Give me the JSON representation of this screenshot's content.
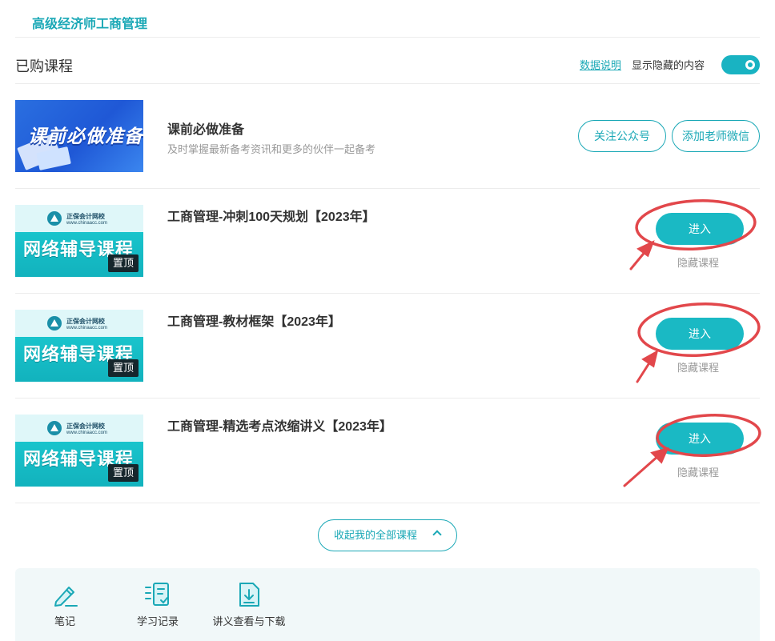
{
  "header": {
    "title": "高级经济师工商管理"
  },
  "purchased": {
    "title": "已购课程",
    "data_link": "数据说明",
    "show_hidden_label": "显示隐藏的内容",
    "show_hidden_on": true
  },
  "prep": {
    "thumb_text": "课前必做准备",
    "title": "课前必做准备",
    "subtitle": "及时掌握最新备考资讯和更多的伙伴一起备考",
    "follow_btn": "关注公众号",
    "wechat_btn": "添加老师微信"
  },
  "course_thumb": {
    "school": "正保会计网校",
    "site": "www.chinaacc.com",
    "banner": "网络辅导课程",
    "pin": "置顶"
  },
  "courses": [
    {
      "title": "工商管理-冲刺100天规划【2023年】",
      "enter": "进入",
      "hide": "隐藏课程"
    },
    {
      "title": "工商管理-教材框架【2023年】",
      "enter": "进入",
      "hide": "隐藏课程"
    },
    {
      "title": "工商管理-精选考点浓缩讲义【2023年】",
      "enter": "进入",
      "hide": "隐藏课程"
    }
  ],
  "collapse_label": "收起我的全部课程",
  "tools": [
    {
      "label": "笔记",
      "icon": "edit-note-icon"
    },
    {
      "label": "学习记录",
      "icon": "study-record-icon"
    },
    {
      "label": "讲义查看与下载",
      "icon": "handout-download-icon"
    }
  ],
  "colors": {
    "accent": "#1aa8b6",
    "button": "#1ab9c4",
    "annotation": "#e2474b"
  }
}
